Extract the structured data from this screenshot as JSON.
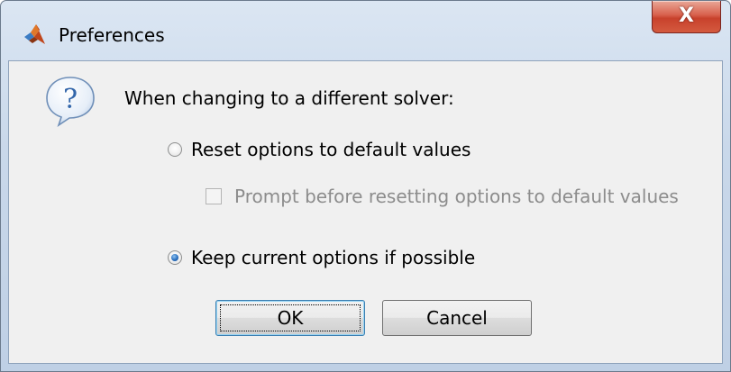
{
  "window": {
    "title": "Preferences",
    "close_label": "X",
    "icon": "matlab-logo-icon"
  },
  "dialog": {
    "icon": "question-icon",
    "heading": "When changing to a different solver:",
    "options": {
      "reset": {
        "label": "Reset options to default values",
        "selected": false
      },
      "prompt": {
        "label": "Prompt before resetting options to default values",
        "checked": false,
        "enabled": false
      },
      "keep": {
        "label": "Keep current options if possible",
        "selected": true
      }
    }
  },
  "buttons": {
    "ok_label": "OK",
    "cancel_label": "Cancel"
  },
  "colors": {
    "title_bar": "#c9d8ea",
    "client_bg": "#f0f0f0",
    "close_button": "#c8412c",
    "radio_selected": "#2a6fbd",
    "disabled_text": "#8c8c8c"
  }
}
